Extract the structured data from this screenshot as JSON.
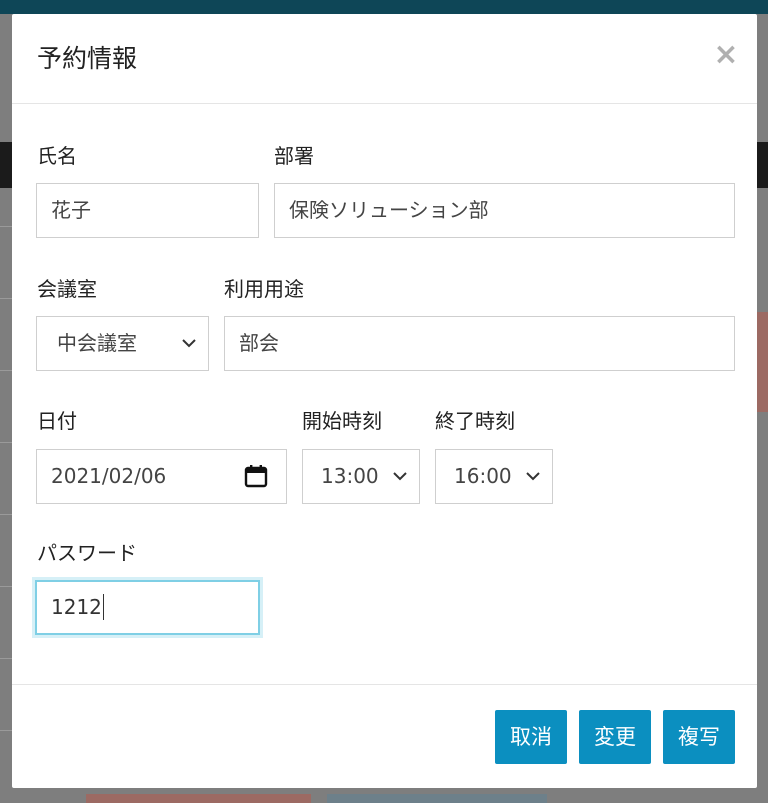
{
  "modal": {
    "title": "予約情報",
    "close_symbol": "×"
  },
  "form": {
    "name": {
      "label": "氏名",
      "value": "花子"
    },
    "department": {
      "label": "部署",
      "value": "保険ソリューション部"
    },
    "room": {
      "label": "会議室",
      "value": "中会議室"
    },
    "purpose": {
      "label": "利用用途",
      "value": "部会"
    },
    "date": {
      "label": "日付",
      "value": "2021/02/06"
    },
    "start_time": {
      "label": "開始時刻",
      "value": "13:00"
    },
    "end_time": {
      "label": "終了時刻",
      "value": "16:00"
    },
    "password": {
      "label": "パスワード",
      "value": "1212"
    }
  },
  "footer": {
    "cancel_label": "取消",
    "change_label": "変更",
    "copy_label": "複写"
  },
  "colors": {
    "button_bg": "#0b8fc0",
    "focus_border": "#7fcfe5",
    "top_bar": "#0e4657"
  },
  "icons": {
    "close": "close-icon",
    "select": "chevron-down-icon",
    "date": "calendar-icon"
  }
}
